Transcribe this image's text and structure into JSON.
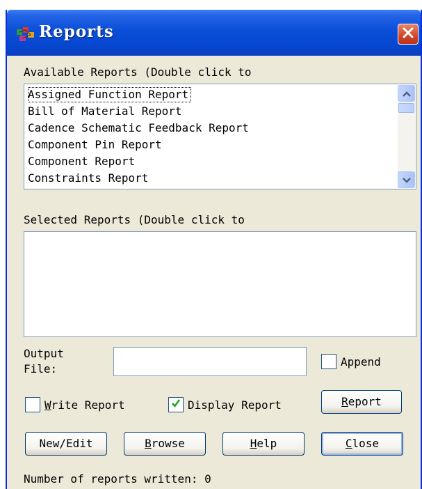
{
  "window": {
    "title": "Reports",
    "accent": "#0a4fd8",
    "close_color": "#d2452a"
  },
  "available": {
    "label": "Available Reports (Double click to",
    "items": [
      "Assigned Function Report",
      "Bill of Material Report",
      "Cadence Schematic Feedback Report",
      "Component Pin Report",
      "Component Report",
      "Constraints Report"
    ]
  },
  "selected": {
    "label": "Selected Reports (Double click to"
  },
  "output": {
    "label_line1": "Output",
    "label_line2": "File:",
    "value": "",
    "append_label": "Append",
    "append_checked": false
  },
  "options": {
    "write_report_label": "Write Report",
    "write_report_checked": false,
    "display_report_label": "Display Report",
    "display_report_checked": true
  },
  "buttons": {
    "report": "Report",
    "new_edit": "New/Edit",
    "browse": "Browse",
    "help": "Help",
    "close": "Close"
  },
  "status": {
    "text": "Number of reports written: 0"
  }
}
